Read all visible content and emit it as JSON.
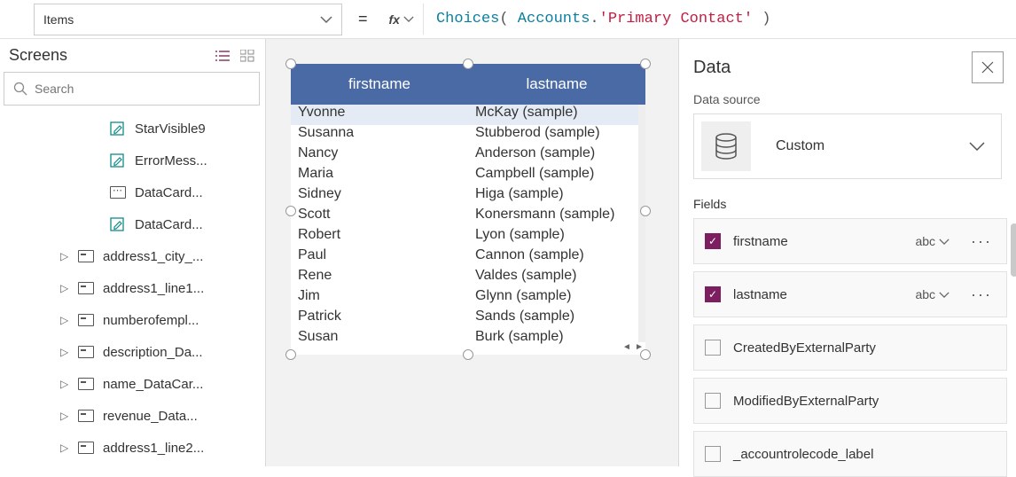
{
  "formula": {
    "property": "Items",
    "fx_label": "fx",
    "text_parts": {
      "fn": "Choices",
      "open": "( ",
      "acc": "Accounts",
      "dot": ".",
      "str": "'Primary Contact'",
      "close": " )"
    }
  },
  "screens": {
    "title": "Screens",
    "search_placeholder": "Search",
    "items": [
      {
        "indent": 1,
        "icon": "rename",
        "label": "StarVisible9"
      },
      {
        "indent": 1,
        "icon": "rename",
        "label": "ErrorMess..."
      },
      {
        "indent": 1,
        "icon": "text",
        "label": "DataCard..."
      },
      {
        "indent": 1,
        "icon": "rename",
        "label": "DataCard..."
      },
      {
        "indent": 2,
        "icon": "card",
        "expandable": true,
        "label": "address1_city_..."
      },
      {
        "indent": 2,
        "icon": "card",
        "expandable": true,
        "label": "address1_line1..."
      },
      {
        "indent": 2,
        "icon": "card",
        "expandable": true,
        "label": "numberofempl..."
      },
      {
        "indent": 2,
        "icon": "card",
        "expandable": true,
        "label": "description_Da..."
      },
      {
        "indent": 2,
        "icon": "card",
        "expandable": true,
        "label": "name_DataCar..."
      },
      {
        "indent": 2,
        "icon": "card",
        "expandable": true,
        "label": "revenue_Data..."
      },
      {
        "indent": 2,
        "icon": "card",
        "expandable": true,
        "label": "address1_line2..."
      }
    ]
  },
  "datatable": {
    "columns": [
      "firstname",
      "lastname"
    ],
    "rows": [
      [
        "Yvonne",
        "McKay (sample)"
      ],
      [
        "Susanna",
        "Stubberod (sample)"
      ],
      [
        "Nancy",
        "Anderson (sample)"
      ],
      [
        "Maria",
        "Campbell (sample)"
      ],
      [
        "Sidney",
        "Higa (sample)"
      ],
      [
        "Scott",
        "Konersmann (sample)"
      ],
      [
        "Robert",
        "Lyon (sample)"
      ],
      [
        "Paul",
        "Cannon (sample)"
      ],
      [
        "Rene",
        "Valdes (sample)"
      ],
      [
        "Jim",
        "Glynn (sample)"
      ],
      [
        "Patrick",
        "Sands (sample)"
      ],
      [
        "Susan",
        "Burk (sample)"
      ]
    ],
    "selected_row": 0
  },
  "dataPanel": {
    "title": "Data",
    "source_label": "Data source",
    "source_name": "Custom",
    "fields_label": "Fields",
    "fields": [
      {
        "name": "firstname",
        "checked": true,
        "type": "abc"
      },
      {
        "name": "lastname",
        "checked": true,
        "type": "abc"
      },
      {
        "name": "CreatedByExternalParty",
        "checked": false
      },
      {
        "name": "ModifiedByExternalParty",
        "checked": false
      },
      {
        "name": "_accountrolecode_label",
        "checked": false
      }
    ]
  }
}
